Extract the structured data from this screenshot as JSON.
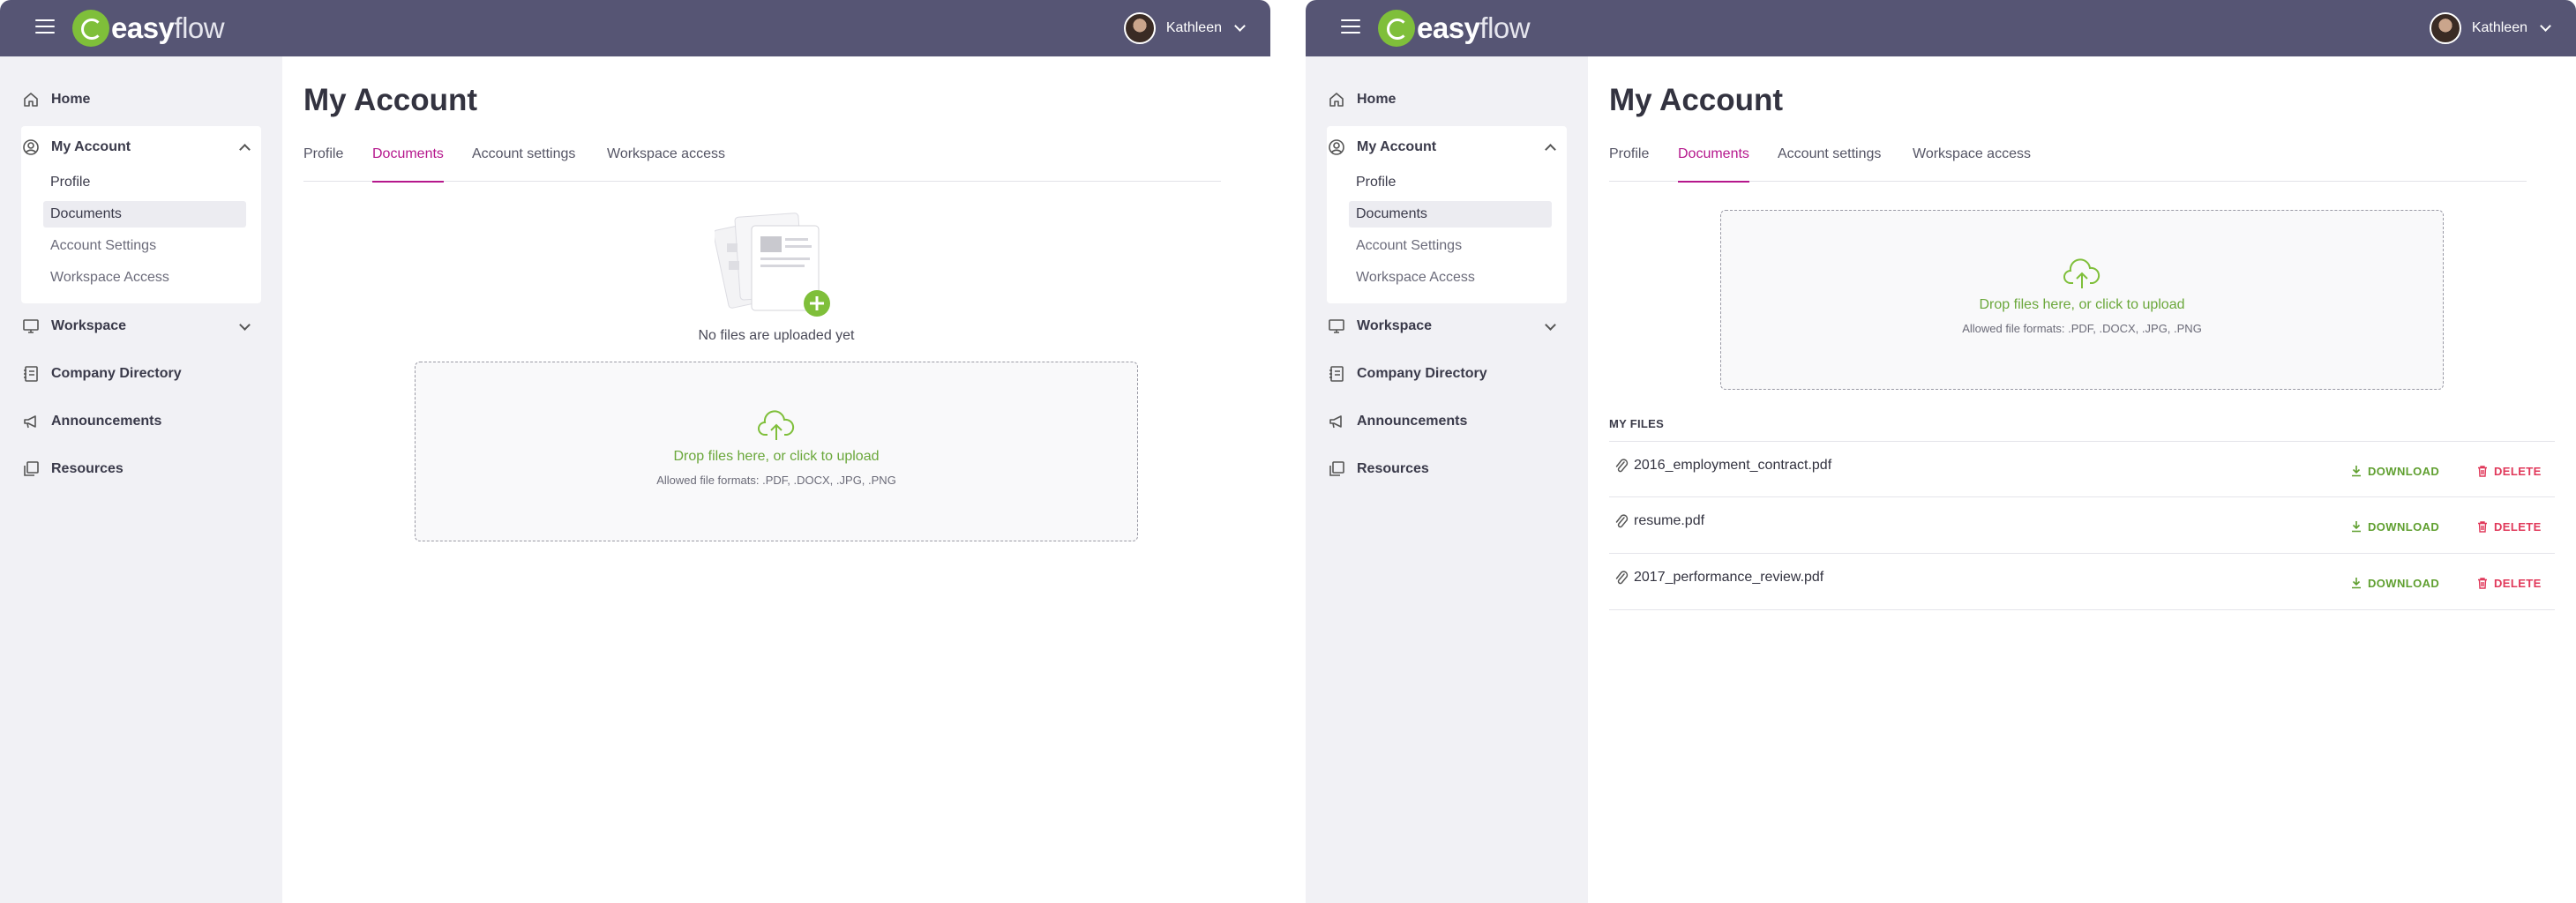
{
  "brand": {
    "name_bold": "easy",
    "name_light": "flow",
    "logo_color": "#7fbf3a",
    "topbar_color": "#565574",
    "accent_color": "#b5178c"
  },
  "user": {
    "name": "Kathleen"
  },
  "sidebar": {
    "items": [
      {
        "label": "Home",
        "icon": "home-icon"
      },
      {
        "label": "My Account",
        "icon": "account-circle-icon"
      },
      {
        "label": "Workspace",
        "icon": "monitor-icon"
      },
      {
        "label": "Company Directory",
        "icon": "directory-icon"
      },
      {
        "label": "Announcements",
        "icon": "megaphone-icon"
      },
      {
        "label": "Resources",
        "icon": "resources-icon"
      }
    ],
    "account_subitems": [
      {
        "label": "Profile"
      },
      {
        "label": "Documents"
      },
      {
        "label": "Account Settings"
      },
      {
        "label": "Workspace Access"
      }
    ]
  },
  "page": {
    "title": "My Account",
    "tabs": [
      {
        "label": "Profile"
      },
      {
        "label": "Documents"
      },
      {
        "label": "Account settings"
      },
      {
        "label": "Workspace access"
      }
    ]
  },
  "upload": {
    "main_text": "Drop files here, or click to upload",
    "formats_text": "Allowed file formats: .PDF, .DOCX, .JPG, .PNG"
  },
  "empty_state": {
    "text": "No files are uploaded yet"
  },
  "files": {
    "heading": "MY FILES",
    "download_label": "DOWNLOAD",
    "delete_label": "DELETE",
    "items": [
      {
        "name": "2016_employment_contract.pdf"
      },
      {
        "name": "resume.pdf"
      },
      {
        "name": "2017_performance_review.pdf"
      }
    ]
  }
}
